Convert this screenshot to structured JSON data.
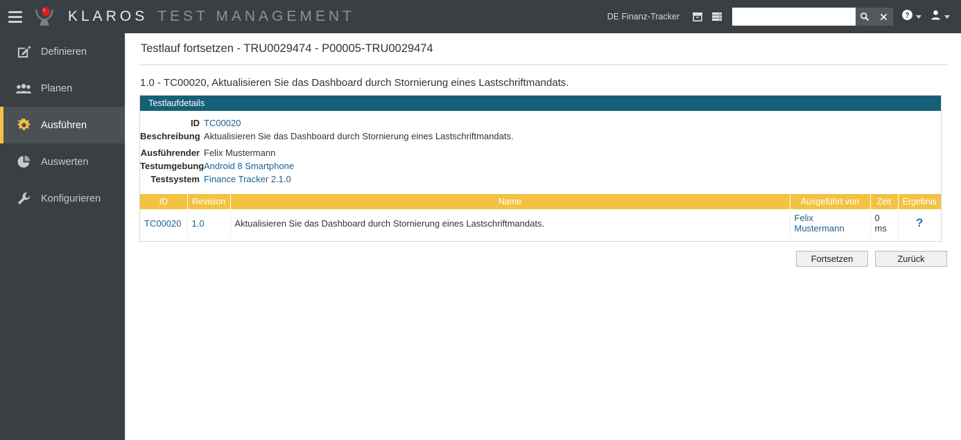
{
  "header": {
    "menu_icon": "hamburger-menu-icon",
    "logo_icon": "klaros-logo-icon",
    "brand_primary": "KLAROS",
    "brand_secondary": "TEST MANAGEMENT",
    "project_name": "DE Finanz-Tracker",
    "archive_icon": "archive-box-icon",
    "server_icon": "server-stack-icon",
    "search_value": "",
    "search_placeholder": "",
    "search_icon": "search-icon",
    "clear_icon": "close-x-icon",
    "help_icon": "help-circle-icon",
    "user_icon": "user-avatar-icon",
    "colors": {
      "bar_bg": "#3a3f44",
      "text": "#d8d8d8"
    }
  },
  "sidebar": {
    "items": [
      {
        "label": "Definieren",
        "icon": "edit-pencil-icon",
        "active": false
      },
      {
        "label": "Planen",
        "icon": "users-group-icon",
        "active": false
      },
      {
        "label": "Ausführen",
        "icon": "gear-icon",
        "active": true
      },
      {
        "label": "Auswerten",
        "icon": "pie-chart-icon",
        "active": false
      },
      {
        "label": "Konfigurieren",
        "icon": "wrench-icon",
        "active": false
      }
    ],
    "accent_color": "#f5c242",
    "bg_color": "#3a3f44"
  },
  "main": {
    "page_title": "Testlauf fortsetzen - TRU0029474 - P00005-TRU0029474",
    "subtitle": "1.0 - TC00020, Aktualisieren Sie das Dashboard durch Stornierung eines Lastschriftmandats.",
    "panel": {
      "title": "Testlaufdetails",
      "header_color": "#166077",
      "fields": [
        {
          "label": "ID",
          "value": "TC00020",
          "is_link": true
        },
        {
          "label": "Beschreibung",
          "value": "Aktualisieren Sie das Dashboard durch Stornierung eines Lastschriftmandats.",
          "is_link": false
        },
        {
          "label": "Ausführender",
          "value": "Felix Mustermann",
          "is_link": false
        },
        {
          "label": "Testumgebung",
          "value": "Android 8 Smartphone",
          "is_link": true
        },
        {
          "label": "Testsystem",
          "value": "Finance Tracker 2.1.0",
          "is_link": true
        }
      ]
    },
    "table": {
      "header_color": "#f3c243",
      "columns": [
        "ID",
        "Revision",
        "Name",
        "Ausgeführt von",
        "Zeit",
        "Ergebnis"
      ],
      "rows": [
        {
          "id": "TC00020",
          "revision": "1.0",
          "name": "Aktualisieren Sie das Dashboard durch Stornierung eines Lastschriftmandats.",
          "executed_by": "Felix Mustermann",
          "time": "0 ms",
          "result_icon": "question-mark-unknown-icon",
          "result_symbol": "?"
        }
      ]
    },
    "buttons": {
      "continue_label": "Fortsetzen",
      "back_label": "Zurück"
    }
  }
}
